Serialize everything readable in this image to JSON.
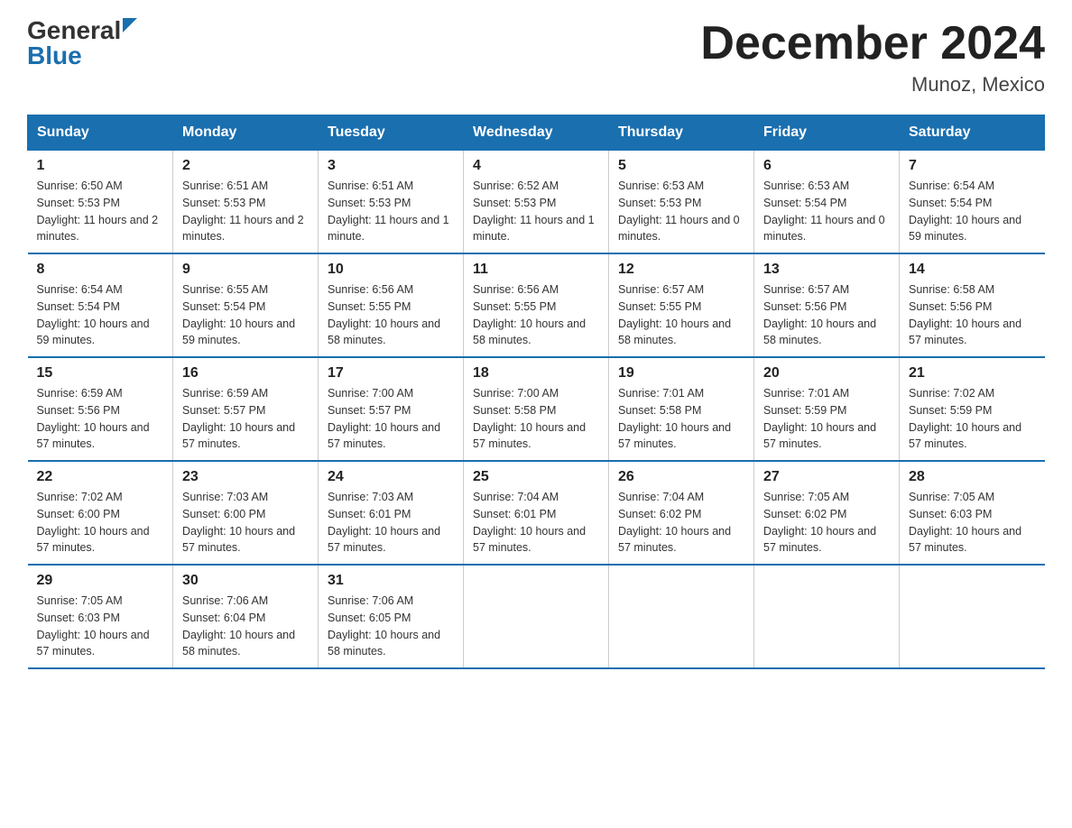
{
  "logo": {
    "general": "General",
    "blue": "Blue"
  },
  "title": "December 2024",
  "location": "Munoz, Mexico",
  "days_of_week": [
    "Sunday",
    "Monday",
    "Tuesday",
    "Wednesday",
    "Thursday",
    "Friday",
    "Saturday"
  ],
  "weeks": [
    [
      {
        "day": "1",
        "sunrise": "6:50 AM",
        "sunset": "5:53 PM",
        "daylight": "11 hours and 2 minutes."
      },
      {
        "day": "2",
        "sunrise": "6:51 AM",
        "sunset": "5:53 PM",
        "daylight": "11 hours and 2 minutes."
      },
      {
        "day": "3",
        "sunrise": "6:51 AM",
        "sunset": "5:53 PM",
        "daylight": "11 hours and 1 minute."
      },
      {
        "day": "4",
        "sunrise": "6:52 AM",
        "sunset": "5:53 PM",
        "daylight": "11 hours and 1 minute."
      },
      {
        "day": "5",
        "sunrise": "6:53 AM",
        "sunset": "5:53 PM",
        "daylight": "11 hours and 0 minutes."
      },
      {
        "day": "6",
        "sunrise": "6:53 AM",
        "sunset": "5:54 PM",
        "daylight": "11 hours and 0 minutes."
      },
      {
        "day": "7",
        "sunrise": "6:54 AM",
        "sunset": "5:54 PM",
        "daylight": "10 hours and 59 minutes."
      }
    ],
    [
      {
        "day": "8",
        "sunrise": "6:54 AM",
        "sunset": "5:54 PM",
        "daylight": "10 hours and 59 minutes."
      },
      {
        "day": "9",
        "sunrise": "6:55 AM",
        "sunset": "5:54 PM",
        "daylight": "10 hours and 59 minutes."
      },
      {
        "day": "10",
        "sunrise": "6:56 AM",
        "sunset": "5:55 PM",
        "daylight": "10 hours and 58 minutes."
      },
      {
        "day": "11",
        "sunrise": "6:56 AM",
        "sunset": "5:55 PM",
        "daylight": "10 hours and 58 minutes."
      },
      {
        "day": "12",
        "sunrise": "6:57 AM",
        "sunset": "5:55 PM",
        "daylight": "10 hours and 58 minutes."
      },
      {
        "day": "13",
        "sunrise": "6:57 AM",
        "sunset": "5:56 PM",
        "daylight": "10 hours and 58 minutes."
      },
      {
        "day": "14",
        "sunrise": "6:58 AM",
        "sunset": "5:56 PM",
        "daylight": "10 hours and 57 minutes."
      }
    ],
    [
      {
        "day": "15",
        "sunrise": "6:59 AM",
        "sunset": "5:56 PM",
        "daylight": "10 hours and 57 minutes."
      },
      {
        "day": "16",
        "sunrise": "6:59 AM",
        "sunset": "5:57 PM",
        "daylight": "10 hours and 57 minutes."
      },
      {
        "day": "17",
        "sunrise": "7:00 AM",
        "sunset": "5:57 PM",
        "daylight": "10 hours and 57 minutes."
      },
      {
        "day": "18",
        "sunrise": "7:00 AM",
        "sunset": "5:58 PM",
        "daylight": "10 hours and 57 minutes."
      },
      {
        "day": "19",
        "sunrise": "7:01 AM",
        "sunset": "5:58 PM",
        "daylight": "10 hours and 57 minutes."
      },
      {
        "day": "20",
        "sunrise": "7:01 AM",
        "sunset": "5:59 PM",
        "daylight": "10 hours and 57 minutes."
      },
      {
        "day": "21",
        "sunrise": "7:02 AM",
        "sunset": "5:59 PM",
        "daylight": "10 hours and 57 minutes."
      }
    ],
    [
      {
        "day": "22",
        "sunrise": "7:02 AM",
        "sunset": "6:00 PM",
        "daylight": "10 hours and 57 minutes."
      },
      {
        "day": "23",
        "sunrise": "7:03 AM",
        "sunset": "6:00 PM",
        "daylight": "10 hours and 57 minutes."
      },
      {
        "day": "24",
        "sunrise": "7:03 AM",
        "sunset": "6:01 PM",
        "daylight": "10 hours and 57 minutes."
      },
      {
        "day": "25",
        "sunrise": "7:04 AM",
        "sunset": "6:01 PM",
        "daylight": "10 hours and 57 minutes."
      },
      {
        "day": "26",
        "sunrise": "7:04 AM",
        "sunset": "6:02 PM",
        "daylight": "10 hours and 57 minutes."
      },
      {
        "day": "27",
        "sunrise": "7:05 AM",
        "sunset": "6:02 PM",
        "daylight": "10 hours and 57 minutes."
      },
      {
        "day": "28",
        "sunrise": "7:05 AM",
        "sunset": "6:03 PM",
        "daylight": "10 hours and 57 minutes."
      }
    ],
    [
      {
        "day": "29",
        "sunrise": "7:05 AM",
        "sunset": "6:03 PM",
        "daylight": "10 hours and 57 minutes."
      },
      {
        "day": "30",
        "sunrise": "7:06 AM",
        "sunset": "6:04 PM",
        "daylight": "10 hours and 58 minutes."
      },
      {
        "day": "31",
        "sunrise": "7:06 AM",
        "sunset": "6:05 PM",
        "daylight": "10 hours and 58 minutes."
      },
      null,
      null,
      null,
      null
    ]
  ]
}
